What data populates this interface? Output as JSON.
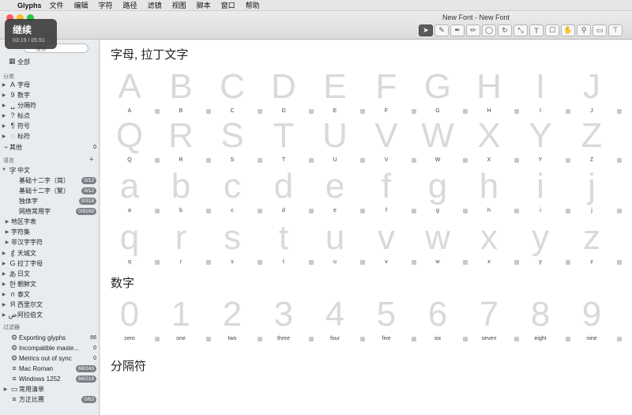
{
  "menubar": {
    "apple_symbol": "",
    "app_name": "Glyphs",
    "items": [
      "文件",
      "编辑",
      "字符",
      "路径",
      "滤镜",
      "视图",
      "脚本",
      "窗口",
      "帮助"
    ]
  },
  "window": {
    "title": "New Font - New Font"
  },
  "toolbar": {
    "tools": [
      {
        "name": "select-tool-icon",
        "glyph": "➤",
        "active": true
      },
      {
        "name": "draw-tool-icon",
        "glyph": "✎"
      },
      {
        "name": "pen-tool-icon",
        "glyph": "✒"
      },
      {
        "name": "pencil-tool-icon",
        "glyph": "✏"
      },
      {
        "name": "ellipse-tool-icon",
        "glyph": "◯"
      },
      {
        "name": "rotate-tool-icon",
        "glyph": "↻"
      },
      {
        "name": "scale-tool-icon",
        "glyph": "⤡"
      },
      {
        "name": "text-tool-icon",
        "glyph": "T"
      },
      {
        "name": "annotation-tool-icon",
        "glyph": "☐"
      },
      {
        "name": "hand-tool-icon",
        "glyph": "✋"
      },
      {
        "name": "zoom-tool-icon",
        "glyph": "⚲"
      },
      {
        "name": "preview-tool-icon",
        "glyph": "▭"
      },
      {
        "name": "measure-tool-icon",
        "glyph": "⊤"
      }
    ]
  },
  "overlay": {
    "label": "继续",
    "time": "03:19 / 05:51"
  },
  "sidebar": {
    "search_placeholder": "搜索",
    "all_label": "全部",
    "categories_header": "分类",
    "categories": [
      {
        "glyph": "A",
        "label": "字母"
      },
      {
        "glyph": "9",
        "label": "数字"
      },
      {
        "glyph": "␣",
        "label": "分隔符"
      },
      {
        "glyph": "?",
        "label": "标点"
      },
      {
        "glyph": "¶",
        "label": "符号"
      },
      {
        "glyph": "◌",
        "label": "标符"
      }
    ],
    "other_label": "其他",
    "other_count": "0",
    "languages_header": "语言",
    "chinese": {
      "glyph": "字",
      "label": "中文"
    },
    "chinese_children": [
      {
        "label": "基础十二字（简）",
        "count": "0/12"
      },
      {
        "label": "基础十二字（繁）",
        "count": "0/12"
      },
      {
        "label": "独体字",
        "count": "0/318"
      },
      {
        "label": "网络常用字",
        "count": "0/9169"
      }
    ],
    "chinese_groups": [
      "地区字表",
      "字符集",
      "非汉字字符"
    ],
    "languages": [
      {
        "glyph": "ई",
        "label": "天城文"
      },
      {
        "glyph": "G",
        "label": "拉丁字母"
      },
      {
        "glyph": "あ",
        "label": "日文"
      },
      {
        "glyph": "한",
        "label": "朝鲜文"
      },
      {
        "glyph": "ก",
        "label": "泰文"
      },
      {
        "glyph": "Я",
        "label": "西里尔文"
      },
      {
        "glyph": "ض",
        "label": "阿拉伯文"
      }
    ],
    "filters_header": "过滤器",
    "filters": [
      {
        "glyph": "⚙",
        "label": "Exporting glyphs",
        "count": "66",
        "pill": false
      },
      {
        "glyph": "⚙",
        "label": "Incompatible maste...",
        "count": "0",
        "pill": false
      },
      {
        "glyph": "⚙",
        "label": "Metrics out of sync",
        "count": "0",
        "pill": false
      },
      {
        "glyph": "≡",
        "label": "Mac Roman",
        "count": "66/243",
        "pill": true
      },
      {
        "glyph": "≡",
        "label": "Windows 1252",
        "count": "66/218",
        "pill": true
      },
      {
        "glyph": "▭",
        "label": "常用清单",
        "count": "",
        "pill": false
      },
      {
        "glyph": "≡",
        "label": "方正比赛",
        "count": "0/63",
        "pill": true
      }
    ]
  },
  "main": {
    "section_letters": "字母, 拉丁文字",
    "section_numbers": "数字",
    "section_separators": "分隔符",
    "letter_rows": [
      [
        {
          "c": "A",
          "n": "A"
        },
        {
          "c": "B",
          "n": "B"
        },
        {
          "c": "C",
          "n": "C"
        },
        {
          "c": "D",
          "n": "D"
        },
        {
          "c": "E",
          "n": "E"
        },
        {
          "c": "F",
          "n": "F"
        },
        {
          "c": "G",
          "n": "G"
        },
        {
          "c": "H",
          "n": "H"
        },
        {
          "c": "I",
          "n": "I"
        },
        {
          "c": "J",
          "n": "J"
        }
      ],
      [
        {
          "c": "Q",
          "n": "Q"
        },
        {
          "c": "R",
          "n": "R"
        },
        {
          "c": "S",
          "n": "S"
        },
        {
          "c": "T",
          "n": "T"
        },
        {
          "c": "U",
          "n": "U"
        },
        {
          "c": "V",
          "n": "V"
        },
        {
          "c": "W",
          "n": "W"
        },
        {
          "c": "X",
          "n": "X"
        },
        {
          "c": "Y",
          "n": "Y"
        },
        {
          "c": "Z",
          "n": "Z"
        }
      ],
      [
        {
          "c": "a",
          "n": "a"
        },
        {
          "c": "b",
          "n": "b"
        },
        {
          "c": "c",
          "n": "c"
        },
        {
          "c": "d",
          "n": "d"
        },
        {
          "c": "e",
          "n": "e"
        },
        {
          "c": "f",
          "n": "f"
        },
        {
          "c": "g",
          "n": "g"
        },
        {
          "c": "h",
          "n": "h"
        },
        {
          "c": "i",
          "n": "i"
        },
        {
          "c": "j",
          "n": "j"
        }
      ],
      [
        {
          "c": "q",
          "n": "q"
        },
        {
          "c": "r",
          "n": "r"
        },
        {
          "c": "s",
          "n": "s"
        },
        {
          "c": "t",
          "n": "t"
        },
        {
          "c": "u",
          "n": "u"
        },
        {
          "c": "v",
          "n": "v"
        },
        {
          "c": "w",
          "n": "w"
        },
        {
          "c": "x",
          "n": "x"
        },
        {
          "c": "y",
          "n": "y"
        },
        {
          "c": "z",
          "n": "z"
        }
      ]
    ],
    "number_row": [
      {
        "c": "0",
        "n": "zero"
      },
      {
        "c": "1",
        "n": "one"
      },
      {
        "c": "2",
        "n": "two"
      },
      {
        "c": "3",
        "n": "three"
      },
      {
        "c": "4",
        "n": "four"
      },
      {
        "c": "5",
        "n": "five"
      },
      {
        "c": "6",
        "n": "six"
      },
      {
        "c": "7",
        "n": "seven"
      },
      {
        "c": "8",
        "n": "eight"
      },
      {
        "c": "9",
        "n": "nine"
      }
    ]
  }
}
